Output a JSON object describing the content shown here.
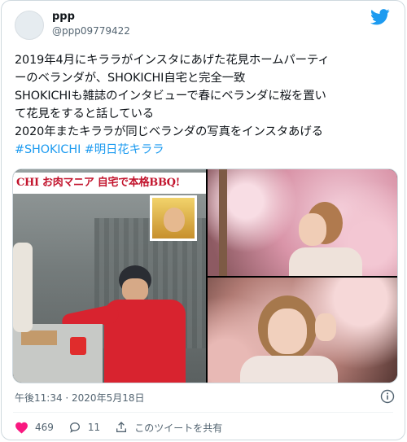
{
  "author": {
    "name": "ppp",
    "handle": "@ppp09779422"
  },
  "tweet": {
    "lines": [
      "2019年4月にキララがインスタにあげた花見ホームパーティ",
      "ーのベランダが、SHOKICHI自宅と完全一致",
      "SHOKICHIも雑誌のインタビューで春にベランダに桜を置い",
      "て花見をすると話している",
      "2020年またキララが同じベランダの写真をインスタあげる"
    ],
    "hashtags": [
      "#SHOKICHI",
      "#明日花キララ"
    ]
  },
  "media": {
    "banner_text": "CHI お肉マニア 自宅で本格BBQ!"
  },
  "footer": {
    "timestamp": "午後11:34 · 2020年5月18日"
  },
  "actions": {
    "likes": "469",
    "replies": "11",
    "share_label": "このツイートを共有"
  },
  "colors": {
    "accent": "#1d9bf0",
    "like": "#f91880",
    "banner_red": "#c2142d"
  },
  "icons": [
    "twitter-bird-icon",
    "info-icon",
    "heart-icon",
    "reply-icon",
    "share-icon"
  ]
}
